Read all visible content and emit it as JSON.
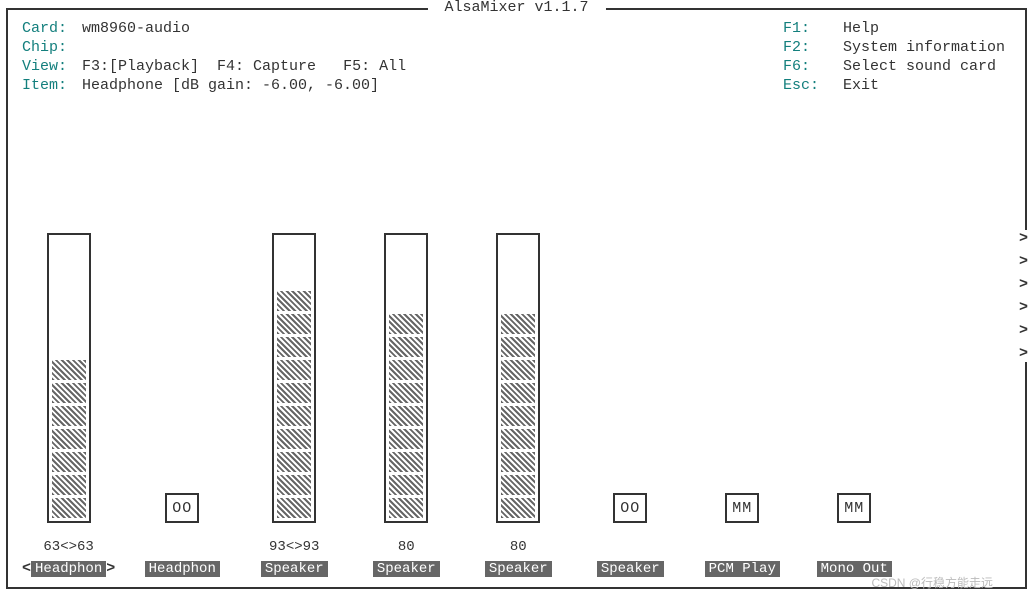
{
  "title": " AlsaMixer v1.1.7 ",
  "info": {
    "card_label": "Card:",
    "card": "wm8960-audio",
    "chip_label": "Chip:",
    "chip": "",
    "view_label": "View:",
    "view_f3": "F3:",
    "view_playback": "[Playback]",
    "view_f4": "F4: Capture",
    "view_f5": "F5: All",
    "item_label": "Item:",
    "item": "Headphone [dB gain: -6.00, -6.00]"
  },
  "help": {
    "f1_k": "F1:",
    "f1_v": "Help",
    "f2_k": "F2:",
    "f2_v_a": "System ",
    "f2_v_b": "information",
    "f6_k": "F6:",
    "f6_v": "Select sound card",
    "esc_k": "Esc:",
    "esc_v": "Exit"
  },
  "channels": [
    {
      "name": "Headphon",
      "vol": "63<>63",
      "level": 7,
      "hasBar": true,
      "mute": "",
      "selected": true
    },
    {
      "name": "Headphon",
      "vol": "",
      "level": 0,
      "hasBar": false,
      "mute": "OO",
      "selected": false
    },
    {
      "name": "Speaker",
      "vol": "93<>93",
      "level": 10,
      "hasBar": true,
      "mute": "",
      "selected": false
    },
    {
      "name": "Speaker",
      "vol": "80",
      "level": 9,
      "hasBar": true,
      "mute": "",
      "selected": false
    },
    {
      "name": "Speaker",
      "vol": "80",
      "level": 9,
      "hasBar": true,
      "mute": "",
      "selected": false
    },
    {
      "name": "Speaker",
      "vol": "",
      "level": 0,
      "hasBar": false,
      "mute": "OO",
      "selected": false
    },
    {
      "name": "PCM Play",
      "vol": "",
      "level": 0,
      "hasBar": false,
      "mute": "MM",
      "selected": false
    },
    {
      "name": "Mono Out",
      "vol": "",
      "level": 0,
      "hasBar": false,
      "mute": "MM",
      "selected": false
    }
  ],
  "scroll_glyph": ">",
  "watermark": "CSDN @行稳方能走远"
}
